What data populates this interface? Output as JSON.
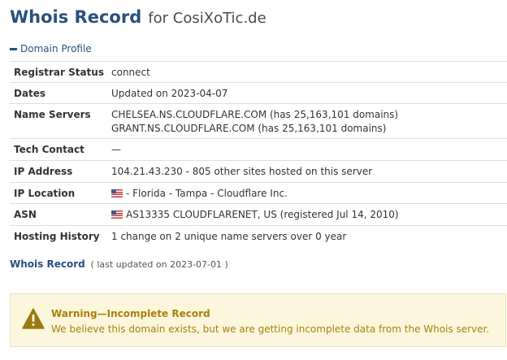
{
  "header": {
    "title": "Whois Record",
    "domain_text": "for CosiXoTic.de"
  },
  "profile": {
    "section_label": "Domain Profile",
    "rows": {
      "registrar_status": {
        "label": "Registrar Status",
        "value": "connect"
      },
      "dates": {
        "label": "Dates",
        "value": "Updated on 2023-04-07"
      },
      "name_servers": {
        "label": "Name Servers",
        "ns1": "CHELSEA.NS.CLOUDFLARE.COM (has 25,163,101 domains)",
        "ns2": "GRANT.NS.CLOUDFLARE.COM (has 25,163,101 domains)"
      },
      "tech_contact": {
        "label": "Tech Contact",
        "value": "—"
      },
      "ip_address": {
        "label": "IP Address",
        "value": "104.21.43.230 - 805 other sites hosted on this server"
      },
      "ip_location": {
        "label": "IP Location",
        "value": "- Florida - Tampa - Cloudflare Inc.",
        "flag": "us-flag-icon"
      },
      "asn": {
        "label": "ASN",
        "value": "AS13335 CLOUDFLARENET, US (registered Jul 14, 2010)",
        "flag": "us-flag-icon"
      },
      "hosting_history": {
        "label": "Hosting History",
        "value": "1 change on 2 unique name servers over 0 year"
      }
    }
  },
  "whois": {
    "link_label": "Whois Record",
    "updated": "( last updated on 2023-07-01 )"
  },
  "warning": {
    "title": "Warning—Incomplete Record",
    "message": "We believe this domain exists, but we are getting incomplete data from the Whois server.",
    "icon": "warning-triangle-icon"
  },
  "colors": {
    "accent": "#2b4f7e",
    "warning_bg": "#fcf7dc",
    "warning_text": "#a87f0d",
    "warning_icon": "#9a7a12"
  }
}
